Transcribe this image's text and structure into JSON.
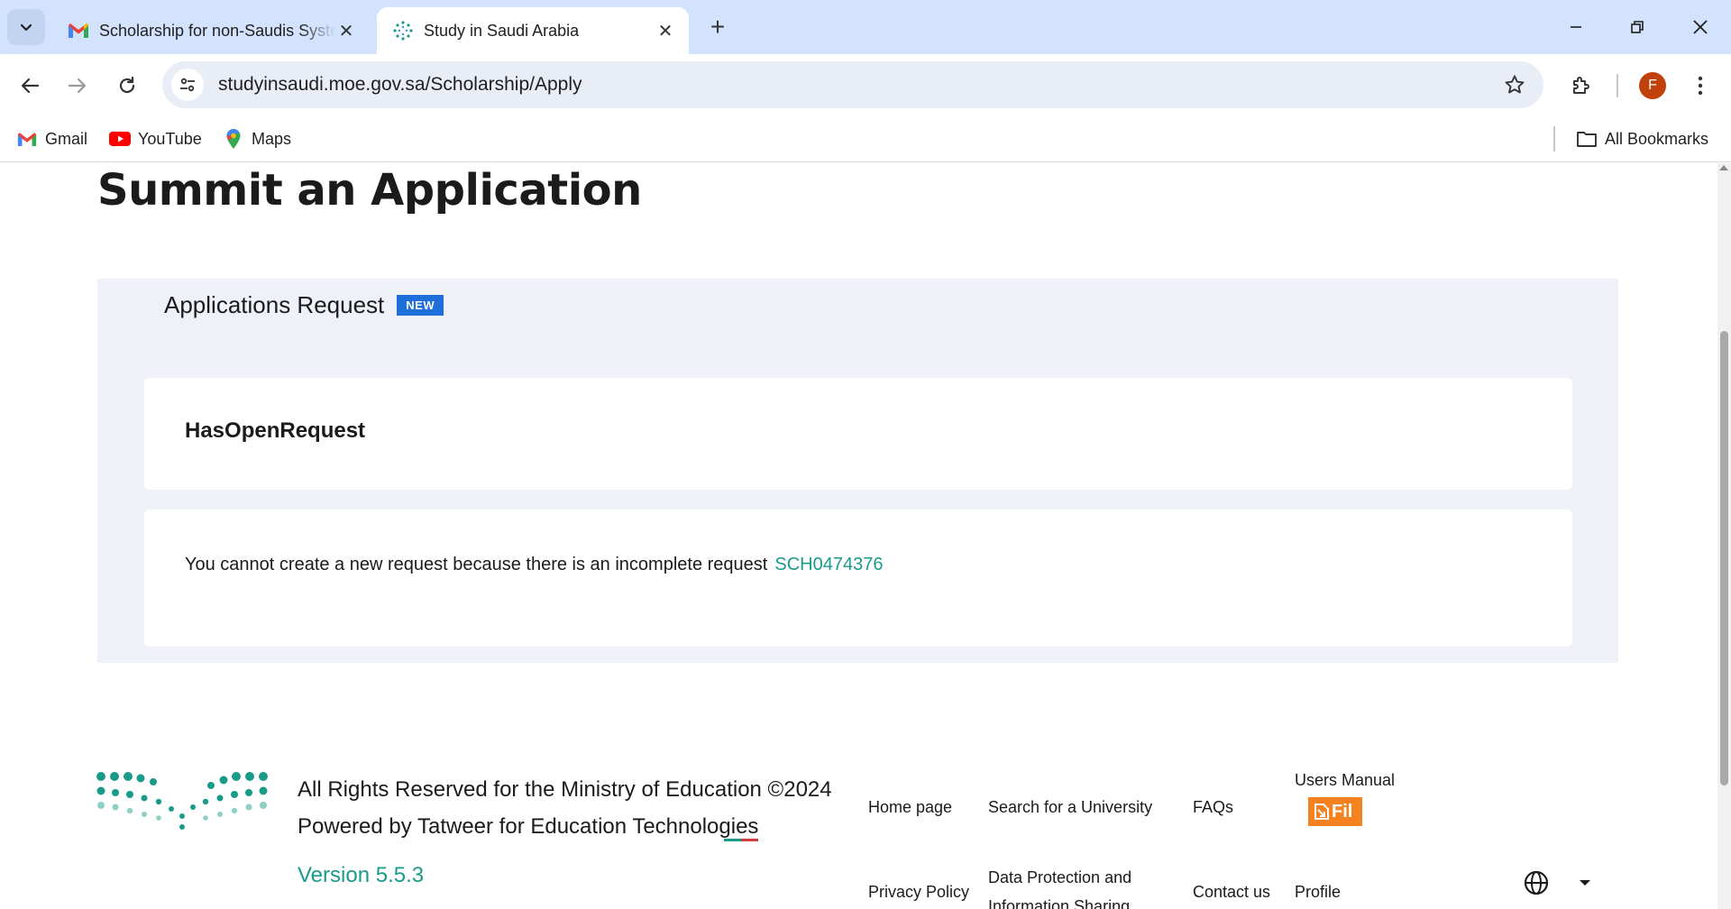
{
  "browser": {
    "tabs": [
      {
        "title": "Scholarship for non-Saudis System",
        "favicon": "gmail-icon",
        "active": false
      },
      {
        "title": "Study in Saudi Arabia",
        "favicon": "moe-leaf-icon",
        "active": true
      }
    ],
    "url": "studyinsaudi.moe.gov.sa/Scholarship/Apply",
    "profile_initial": "F",
    "profile_color": "#c1410d",
    "bookmarks": [
      {
        "label": "Gmail",
        "icon": "gmail-icon"
      },
      {
        "label": "YouTube",
        "icon": "youtube-icon"
      },
      {
        "label": "Maps",
        "icon": "maps-icon"
      }
    ],
    "all_bookmarks_label": "All Bookmarks"
  },
  "page": {
    "title": "Summit an Application",
    "panel": {
      "heading": "Applications Request",
      "badge": "NEW"
    },
    "open_request_heading": "HasOpenRequest",
    "message": "You cannot create a new request because there is an incomplete request",
    "request_code": "SCH0474376"
  },
  "footer": {
    "rights": "All Rights Reserved for the Ministry of Education ©2024",
    "powered_by": "Powered by Tatweer for Education Technologies",
    "version": "Version 5.5.3",
    "links": {
      "home": "Home page",
      "search_university": "Search for a University",
      "faqs": "FAQs",
      "users_manual": "Users Manual",
      "privacy": "Privacy Policy",
      "data_protection_1": "Data Protection and",
      "data_protection_2": "Information Sharing",
      "contact": "Contact us",
      "profile": "Profile"
    },
    "file_badge_text": "Fil"
  },
  "colors": {
    "accent_teal": "#1a9b8a",
    "badge_blue": "#1e6fd9",
    "panel_bg": "#eef1f8",
    "tabbar_bg": "#d3e3fd",
    "file_orange": "#f58220"
  }
}
